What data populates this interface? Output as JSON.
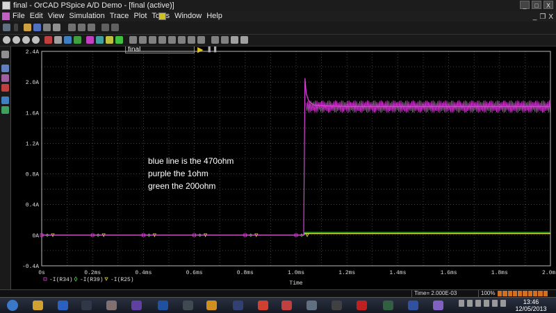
{
  "window": {
    "title": "final - OrCAD PSpice A/D Demo - [final (active)]",
    "btn_minimize": "_",
    "btn_maximize": "□",
    "btn_close": "X"
  },
  "menu": {
    "items": [
      "File",
      "Edit",
      "View",
      "Simulation",
      "Trace",
      "Plot",
      "Tools",
      "Window",
      "Help"
    ],
    "mdi_minimize": "_",
    "mdi_restore": "❐",
    "mdi_close": "X"
  },
  "toolbar": {
    "simulation_profile": "final",
    "run_icon": "play-icon",
    "pause_icon": "pause-icon"
  },
  "annotation": {
    "line1": "blue line is the 470ohm",
    "line2": "purple the 1ohm",
    "line3": "green the 200ohm"
  },
  "chart_data": {
    "type": "line",
    "xlabel": "Time",
    "x_ticks": [
      "0s",
      "0.2ms",
      "0.4ms",
      "0.6ms",
      "0.8ms",
      "1.0ms",
      "1.2ms",
      "1.4ms",
      "1.6ms",
      "1.8ms",
      "2.0ms"
    ],
    "x_tick_values": [
      0,
      0.2,
      0.4,
      0.6,
      0.8,
      1.0,
      1.2,
      1.4,
      1.6,
      1.8,
      2.0
    ],
    "y_ticks": [
      "2.4A",
      "2.0A",
      "1.6A",
      "1.2A",
      "0.8A",
      "0.4A",
      "0A",
      "-0.4A"
    ],
    "y_tick_values": [
      2.4,
      2.0,
      1.6,
      1.2,
      0.8,
      0.4,
      0,
      -0.4
    ],
    "xlim": [
      0,
      2.0
    ],
    "ylim": [
      -0.4,
      2.4
    ],
    "grid": true,
    "background": "#000000",
    "series": [
      {
        "name": "-I(R34)",
        "color": "#e040e0",
        "marker": "□",
        "segments": [
          {
            "x": [
              0,
              1.03,
              1.03
            ],
            "y": [
              0,
              0,
              0.05
            ]
          },
          {
            "x": [
              1.03,
              1.035,
              1.04,
              1.05,
              1.07,
              1.1,
              1.2,
              1.4,
              1.6,
              1.8,
              2.0
            ],
            "y": [
              0.05,
              2.05,
              1.85,
              1.75,
              1.7,
              1.69,
              1.68,
              1.68,
              1.68,
              1.68,
              1.68
            ]
          }
        ],
        "ripple": {
          "from": 1.04,
          "to": 2.0,
          "center": 1.68,
          "amplitude": 0.08
        }
      },
      {
        "name": "-I(R39)",
        "color": "#40d040",
        "marker": "◇",
        "segments": [
          {
            "x": [
              0,
              1.03,
              1.035,
              2.0
            ],
            "y": [
              0,
              0,
              0.035,
              0.035
            ]
          }
        ]
      },
      {
        "name": "-I(R25)",
        "color": "#e0e040",
        "marker": "▽",
        "segments": [
          {
            "x": [
              0,
              1.03,
              1.035,
              2.0
            ],
            "y": [
              0,
              0,
              0.02,
              0.02
            ]
          }
        ]
      }
    ]
  },
  "status": {
    "time": "Time= 2.000E-03",
    "zoom": "100%"
  },
  "tray": {
    "time": "13:46",
    "date": "12/05/2013"
  },
  "taskbar_icons": [
    "start-orb-icon",
    "explorer-icon",
    "internet-explorer-icon",
    "media-player-icon",
    "app-icon-5",
    "app-icon-6",
    "photoshop-icon",
    "app-icon-8",
    "word-icon",
    "app-icon-10",
    "chrome-icon",
    "app-icon-12",
    "app-icon-13",
    "app-icon-14",
    "adobe-reader-icon",
    "app-icon-16",
    "app-icon-17",
    "pspice-icon"
  ]
}
